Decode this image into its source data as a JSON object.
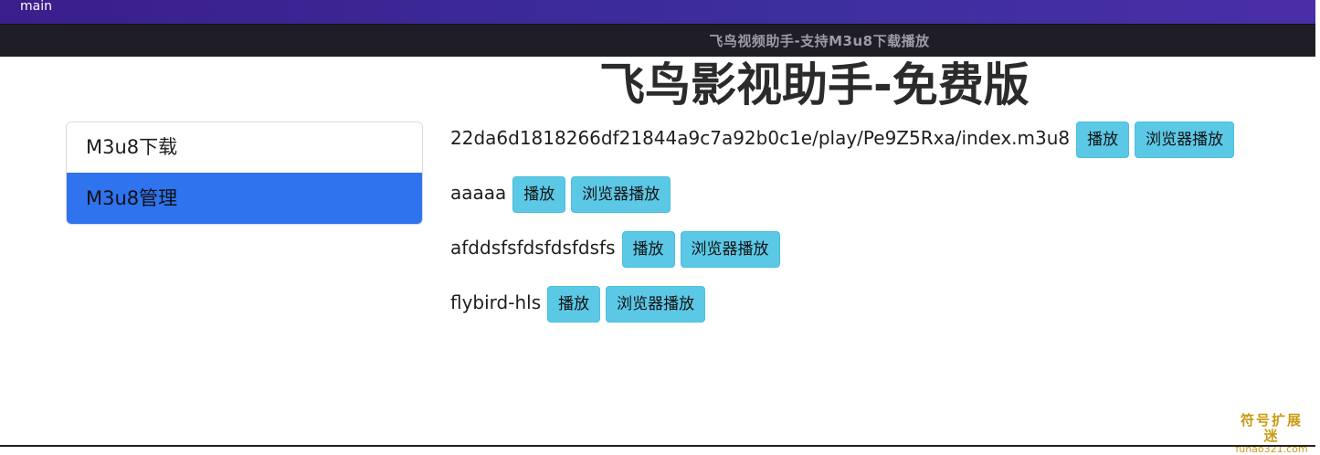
{
  "window": {
    "strip_label": "main",
    "title": "飞鸟视频助手-支持M3u8下载播放"
  },
  "page": {
    "heading": "飞鸟影视助手-免费版"
  },
  "menu": {
    "items": [
      {
        "label": "M3u8下载",
        "active": false
      },
      {
        "label": "M3u8管理",
        "active": true
      }
    ]
  },
  "list": {
    "rows": [
      {
        "name": "22da6d1818266df21844a9c7a92b0c1e/play/Pe9Z5Rxa/index.m3u8",
        "play_label": "播放",
        "browser_play_label": "浏览器播放"
      },
      {
        "name": "aaaaa",
        "play_label": "播放",
        "browser_play_label": "浏览器播放"
      },
      {
        "name": "afddsfsfdsfdsfdsfs",
        "play_label": "播放",
        "browser_play_label": "浏览器播放"
      },
      {
        "name": "flybird-hls",
        "play_label": "播放",
        "browser_play_label": "浏览器播放"
      }
    ]
  },
  "watermark": {
    "line1": "符号扩展迷",
    "line2": "fuhao321.com"
  },
  "colors": {
    "active_menu": "#2f73ef",
    "button": "#5bc8e6",
    "titlebar": "#1f1e26",
    "top_strip": "#3a1e8c"
  }
}
